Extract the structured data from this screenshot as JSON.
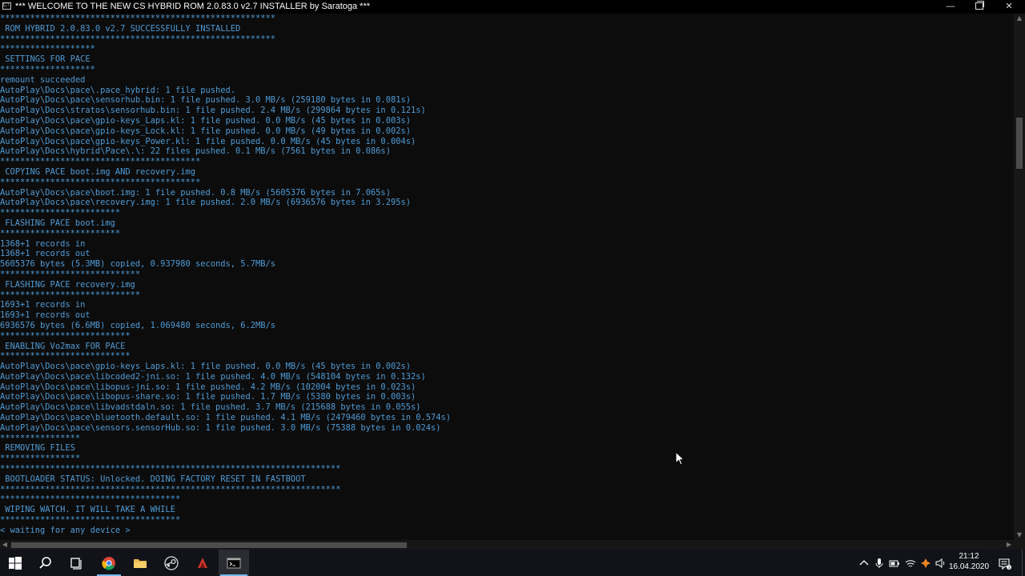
{
  "window": {
    "title": "*** WELCOME TO THE NEW CS HYBRID ROM 2.0.83.0 v2.7 INSTALLER by Saratoga ***",
    "minimize_glyph": "—",
    "close_glyph": "✕"
  },
  "console": {
    "lines": [
      "*******************************************************",
      " ROM HYBRID 2.0.83.0 v2.7 SUCCESSFULLY INSTALLED",
      "*******************************************************",
      "*******************",
      " SETTINGS FOR PACE",
      "*******************",
      "remount succeeded",
      "AutoPlay\\Docs\\pace\\.pace_hybrid: 1 file pushed.",
      "AutoPlay\\Docs\\pace\\sensorhub.bin: 1 file pushed. 3.0 MB/s (259180 bytes in 0.081s)",
      "AutoPlay\\Docs\\stratos\\sensorhub.bin: 1 file pushed. 2.4 MB/s (299864 bytes in 0.121s)",
      "AutoPlay\\Docs\\pace\\gpio-keys_Laps.kl: 1 file pushed. 0.0 MB/s (45 bytes in 0.003s)",
      "AutoPlay\\Docs\\pace\\gpio-keys_Lock.kl: 1 file pushed. 0.0 MB/s (49 bytes in 0.002s)",
      "AutoPlay\\Docs\\pace\\gpio-keys_Power.kl: 1 file pushed. 0.0 MB/s (45 bytes in 0.004s)",
      "AutoPlay\\Docs\\hybrid\\Pace\\.\\: 22 files pushed. 0.1 MB/s (7561 bytes in 0.086s)",
      "****************************************",
      " COPYING PACE boot.img AND recovery.img",
      "****************************************",
      "AutoPlay\\Docs\\pace\\boot.img: 1 file pushed. 0.8 MB/s (5605376 bytes in 7.065s)",
      "AutoPlay\\Docs\\pace\\recovery.img: 1 file pushed. 2.0 MB/s (6936576 bytes in 3.295s)",
      "************************",
      " FLASHING PACE boot.img",
      "************************",
      "1368+1 records in",
      "1368+1 records out",
      "5605376 bytes (5.3MB) copied, 0.937980 seconds, 5.7MB/s",
      "****************************",
      " FLASHING PACE recovery.img",
      "****************************",
      "1693+1 records in",
      "1693+1 records out",
      "6936576 bytes (6.6MB) copied, 1.069480 seconds, 6.2MB/s",
      "**************************",
      " ENABLING Vo2max FOR PACE",
      "**************************",
      "AutoPlay\\Docs\\pace\\gpio-keys_Laps.kl: 1 file pushed. 0.0 MB/s (45 bytes in 0.002s)",
      "AutoPlay\\Docs\\pace\\libcoded2-jni.so: 1 file pushed. 4.0 MB/s (548104 bytes in 0.132s)",
      "AutoPlay\\Docs\\pace\\libopus-jni.so: 1 file pushed. 4.2 MB/s (102004 bytes in 0.023s)",
      "AutoPlay\\Docs\\pace\\libopus-share.so: 1 file pushed. 1.7 MB/s (5380 bytes in 0.003s)",
      "AutoPlay\\Docs\\pace\\libvadstdaln.so: 1 file pushed. 3.7 MB/s (215688 bytes in 0.055s)",
      "AutoPlay\\Docs\\pace\\bluetooth.default.so: 1 file pushed. 4.1 MB/s (2479460 bytes in 0.574s)",
      "AutoPlay\\Docs\\pace\\sensors.sensorHub.so: 1 file pushed. 3.0 MB/s (75388 bytes in 0.024s)",
      "****************",
      " REMOVING FILES",
      "****************",
      "********************************************************************",
      " BOOTLOADER STATUS: Unlocked. DOING FACTORY RESET IN FASTBOOT",
      "********************************************************************",
      "************************************",
      " WIPING WATCH. IT WILL TAKE A WHILE",
      "************************************",
      "< waiting for any device >"
    ]
  },
  "scrollbars": {
    "up": "▲",
    "down": "▼",
    "left": "◀",
    "right": "▶"
  },
  "taskbar": {
    "icons": [
      "windows-start-icon",
      "search-icon",
      "task-view-icon",
      "chrome-icon",
      "file-explorer-icon",
      "steam-icon",
      "app-icon",
      "terminal-icon"
    ],
    "clock_time": "21:12",
    "clock_date": "16.04.2020",
    "notification_badge": "3"
  },
  "colors": {
    "console_background": "#0c0c0c",
    "console_text": "#4e9bd6",
    "taskbar": "#111318",
    "accent": "#76b9ed"
  }
}
